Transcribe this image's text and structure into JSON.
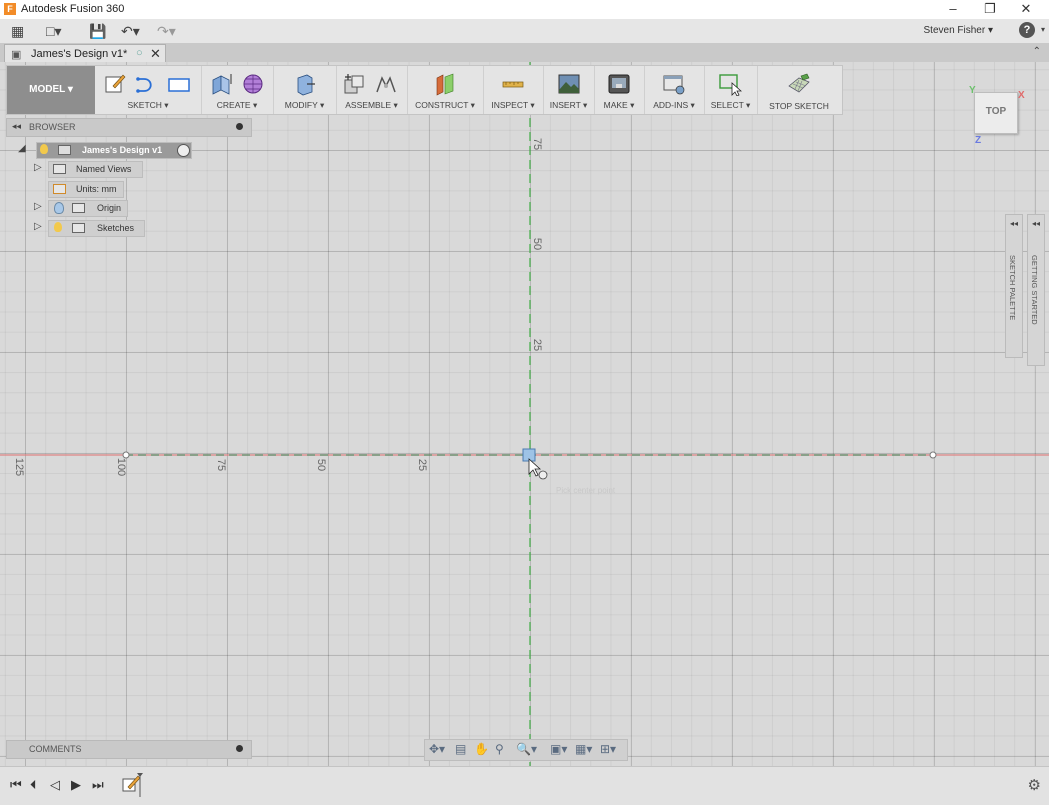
{
  "window": {
    "app_logo": "F",
    "title": "Autodesk Fusion 360",
    "minimize_icon": "minimize-icon",
    "restore_icon": "restore-icon",
    "close_icon": "close-icon"
  },
  "quick_access": {
    "user_name": "Steven Fisher ▾",
    "help_label": "?"
  },
  "document_tab": {
    "name": "James's Design v1*",
    "close": "✕"
  },
  "toolbar": {
    "workspace": "MODEL ▾",
    "groups": [
      {
        "label": "SKETCH ▾"
      },
      {
        "label": "CREATE ▾"
      },
      {
        "label": "MODIFY ▾"
      },
      {
        "label": "ASSEMBLE ▾"
      },
      {
        "label": "CONSTRUCT ▾"
      },
      {
        "label": "INSPECT ▾"
      },
      {
        "label": "INSERT ▾"
      },
      {
        "label": "MAKE ▾"
      },
      {
        "label": "ADD-INS ▾"
      },
      {
        "label": "SELECT ▾"
      },
      {
        "label": "STOP SKETCH"
      }
    ]
  },
  "browser": {
    "collapse": "◂◂",
    "title": "BROWSER",
    "root": "James's Design v1",
    "items": [
      {
        "label": "Named Views"
      },
      {
        "label": "Units: mm"
      },
      {
        "label": "Origin"
      },
      {
        "label": "Sketches"
      }
    ]
  },
  "canvas": {
    "vertical_ticks": [
      "75",
      "50",
      "25"
    ],
    "horizontal_ticks": [
      "125",
      "100",
      "75",
      "50",
      "25"
    ],
    "hint_text": "Pick center point"
  },
  "viewcube": {
    "face": "TOP",
    "x": "X",
    "y": "Y",
    "z": "Z"
  },
  "palettes": {
    "sketch_palette": "SKETCH PALETTE",
    "getting_started": "GETTING STARTED",
    "arrows": "◂◂"
  },
  "comments": {
    "collapse": "◂◂",
    "title": "COMMENTS"
  },
  "colors": {
    "accent": "#f28c28",
    "x_axis": "#e05a5a",
    "y_axis": "#4caf50",
    "grid": "#d9d9d9"
  }
}
